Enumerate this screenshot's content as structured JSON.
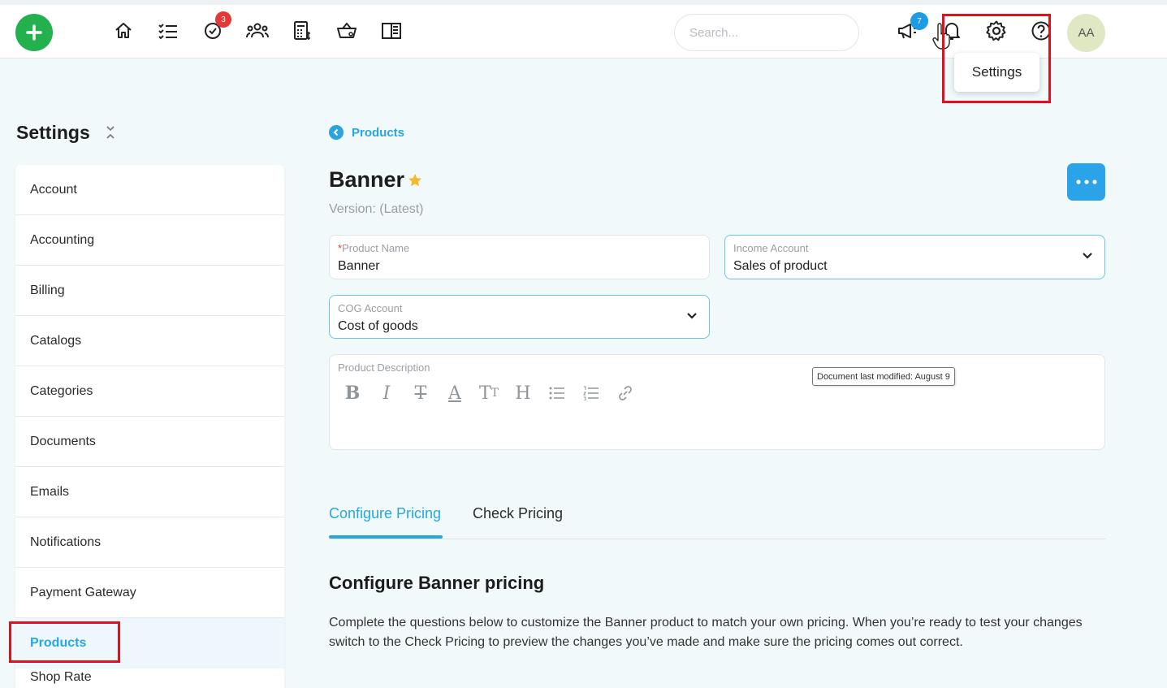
{
  "topbar": {
    "search_placeholder": "Search...",
    "tasks_badge": "3",
    "announcements_badge": "7",
    "avatar_initials": "AA",
    "settings_tooltip": "Settings"
  },
  "sidebar": {
    "title": "Settings",
    "items": [
      {
        "label": "Account"
      },
      {
        "label": "Accounting"
      },
      {
        "label": "Billing"
      },
      {
        "label": "Catalogs"
      },
      {
        "label": "Categories"
      },
      {
        "label": "Documents"
      },
      {
        "label": "Emails"
      },
      {
        "label": "Notifications"
      },
      {
        "label": "Payment Gateway"
      },
      {
        "label": "Products"
      },
      {
        "label": "Shop Rate"
      }
    ],
    "active_item": "Products"
  },
  "main": {
    "breadcrumb": "Products",
    "title": "Banner",
    "version": "Version: (Latest)",
    "fields": {
      "product_name": {
        "label": "Product Name",
        "required_mark": "*",
        "value": "Banner"
      },
      "income_account": {
        "label": "Income Account",
        "value": "Sales of product"
      },
      "cog_account": {
        "label": "COG Account",
        "value": "Cost of goods"
      },
      "description": {
        "label": "Product Description"
      }
    },
    "modified_tooltip": "Document last modified: August 9",
    "tabs": [
      {
        "label": "Configure Pricing"
      },
      {
        "label": "Check Pricing"
      }
    ],
    "section_title": "Configure Banner pricing",
    "section_text": "Complete the questions below to customize the Banner product to match your own pricing. When you’re ready to test your changes switch to the Check Pricing to preview the changes you’ve made and make sure the pricing comes out correct."
  },
  "colors": {
    "accent": "#26a7de",
    "add_button": "#22b14c",
    "highlight_box": "#e0101e"
  },
  "icons": [
    "plus-icon",
    "home-icon",
    "list-icon",
    "check-circle-icon",
    "people-icon",
    "calculator-icon",
    "basket-icon",
    "book-icon",
    "megaphone-icon",
    "bell-icon",
    "gear-icon",
    "help-icon",
    "collapse-icon",
    "chevron-left-icon",
    "star-icon",
    "more-icon",
    "chevron-down-icon"
  ]
}
